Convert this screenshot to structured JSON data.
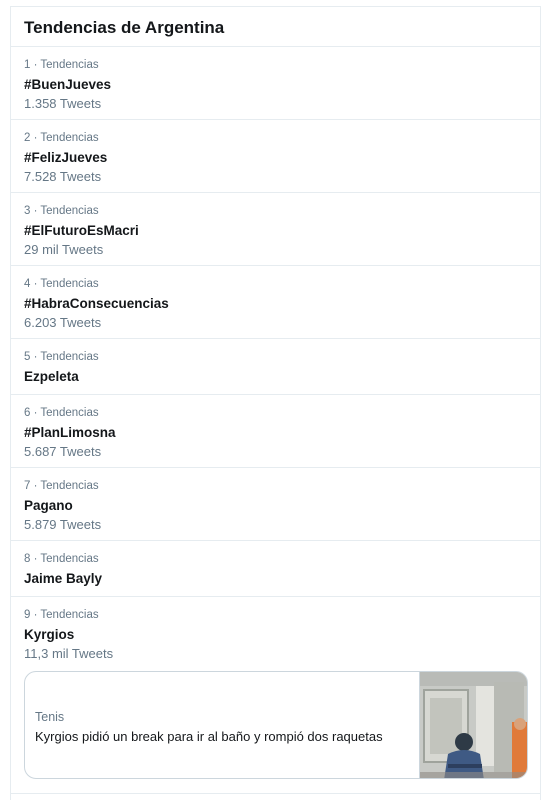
{
  "header": {
    "title": "Tendencias de Argentina"
  },
  "trends": [
    {
      "meta": "1 · Tendencias",
      "name": "#BuenJueves",
      "count": "1.358 Tweets"
    },
    {
      "meta": "2 · Tendencias",
      "name": "#FelizJueves",
      "count": "7.528 Tweets"
    },
    {
      "meta": "3 · Tendencias",
      "name": "#ElFuturoEsMacri",
      "count": "29 mil Tweets"
    },
    {
      "meta": "4 · Tendencias",
      "name": "#HabraConsecuencias",
      "count": "6.203 Tweets"
    },
    {
      "meta": "5 · Tendencias",
      "name": "Ezpeleta",
      "count": ""
    },
    {
      "meta": "6 · Tendencias",
      "name": "#PlanLimosna",
      "count": "5.687 Tweets"
    },
    {
      "meta": "7 · Tendencias",
      "name": "Pagano",
      "count": "5.879 Tweets"
    },
    {
      "meta": "8 · Tendencias",
      "name": "Jaime Bayly",
      "count": ""
    },
    {
      "meta": "9 · Tendencias",
      "name": "Kyrgios",
      "count": "11,3 mil Tweets"
    }
  ],
  "news_card": {
    "category": "Tenis",
    "title": "Kyrgios pidió un break para ir al baño y rompió dos raquetas",
    "image": "tennis-player-photo"
  },
  "colors": {
    "text": "#14171a",
    "secondary": "#657786",
    "border": "#e6ecf0"
  }
}
